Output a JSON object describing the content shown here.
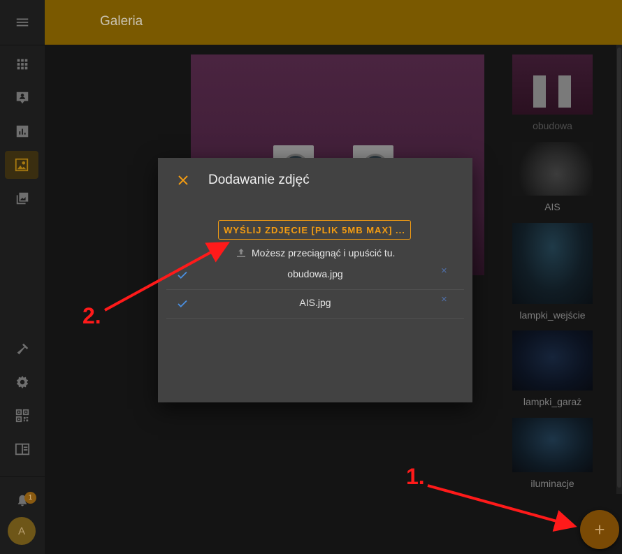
{
  "header": {
    "title": "Galeria"
  },
  "dialog": {
    "title": "Dodawanie zdjęć",
    "upload_button": "WYŚLIJ ZDJĘCIE [PLIK 5MB MAX] ...",
    "drop_hint": "Możesz przeciągnąć i upuścić tu.",
    "files": [
      {
        "name": "obudowa.jpg",
        "remove": "×"
      },
      {
        "name": "AIS.jpg",
        "remove": "×"
      }
    ]
  },
  "gallery": {
    "thumbnails": [
      {
        "label": "obudowa"
      },
      {
        "label": "AIS"
      },
      {
        "label": "lampki_wejście"
      },
      {
        "label": "lampki_garaż"
      },
      {
        "label": "iluminacje"
      }
    ]
  },
  "sidebar": {
    "notification_count": "1",
    "avatar_initial": "A"
  },
  "fab": {
    "label": "+"
  },
  "annotations": {
    "step1": "1.",
    "step2": "2."
  },
  "colors": {
    "header": "#7a5900",
    "accent": "#f39c12",
    "dialog_bg": "#424242",
    "check": "#4a90e2",
    "annotation": "#ff1a1a"
  }
}
